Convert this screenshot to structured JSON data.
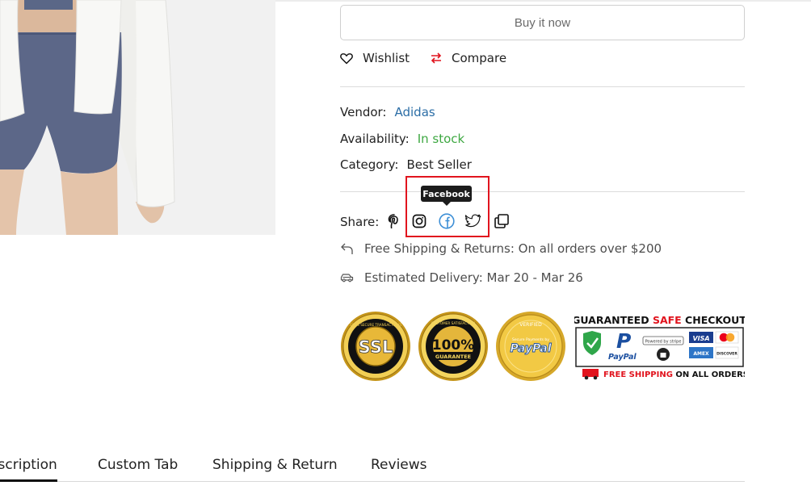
{
  "buy_button": {
    "label": "Buy it now"
  },
  "actions": {
    "wishlist_label": "Wishlist",
    "compare_label": "Compare"
  },
  "meta": {
    "vendor_label": "Vendor:",
    "vendor_value": "Adidas",
    "availability_label": "Availability:",
    "availability_value": "In stock",
    "category_label": "Category:",
    "category_value": "Best Seller"
  },
  "share": {
    "label": "Share:",
    "icons": [
      "pinterest-icon",
      "instagram-icon",
      "facebook-icon",
      "twitter-icon",
      "copy-link-icon"
    ],
    "tooltip": "Facebook"
  },
  "info": {
    "shipping": "Free Shipping & Returns: On all orders over $200",
    "delivery": "Estimated Delivery: Mar 20 - Mar 26"
  },
  "trust_badges": {
    "ssl": {
      "main": "SSL",
      "ring": "100% SECURE TRANSACTIONS"
    },
    "guarantee": {
      "main": "100%",
      "sub": "GUARANTEE",
      "ring": "CUSTOMER SATISFACTION"
    },
    "paypal": {
      "top": "VERIFIED",
      "line1": "Secure Payments by",
      "main": "PayPal"
    },
    "checkout": {
      "title_part1": "GUARANTEED ",
      "title_part2": "SAFE",
      "title_part3": " CHECKOUT",
      "paypal": "PayPal",
      "stripe": "Powered by stripe",
      "card1": "VISA",
      "card2": "AMEX",
      "card3": "DISCOVER",
      "footer_part1": "FREE SHIPPING",
      "footer_part2": " ON ALL ORDERS"
    }
  },
  "tabs": [
    "Description",
    "Custom Tab",
    "Shipping & Return",
    "Reviews"
  ],
  "colors": {
    "accent_red": "#e1141e",
    "link_blue": "#2c6ea6",
    "stock_green": "#3ea842",
    "gold": "#d4a017"
  }
}
